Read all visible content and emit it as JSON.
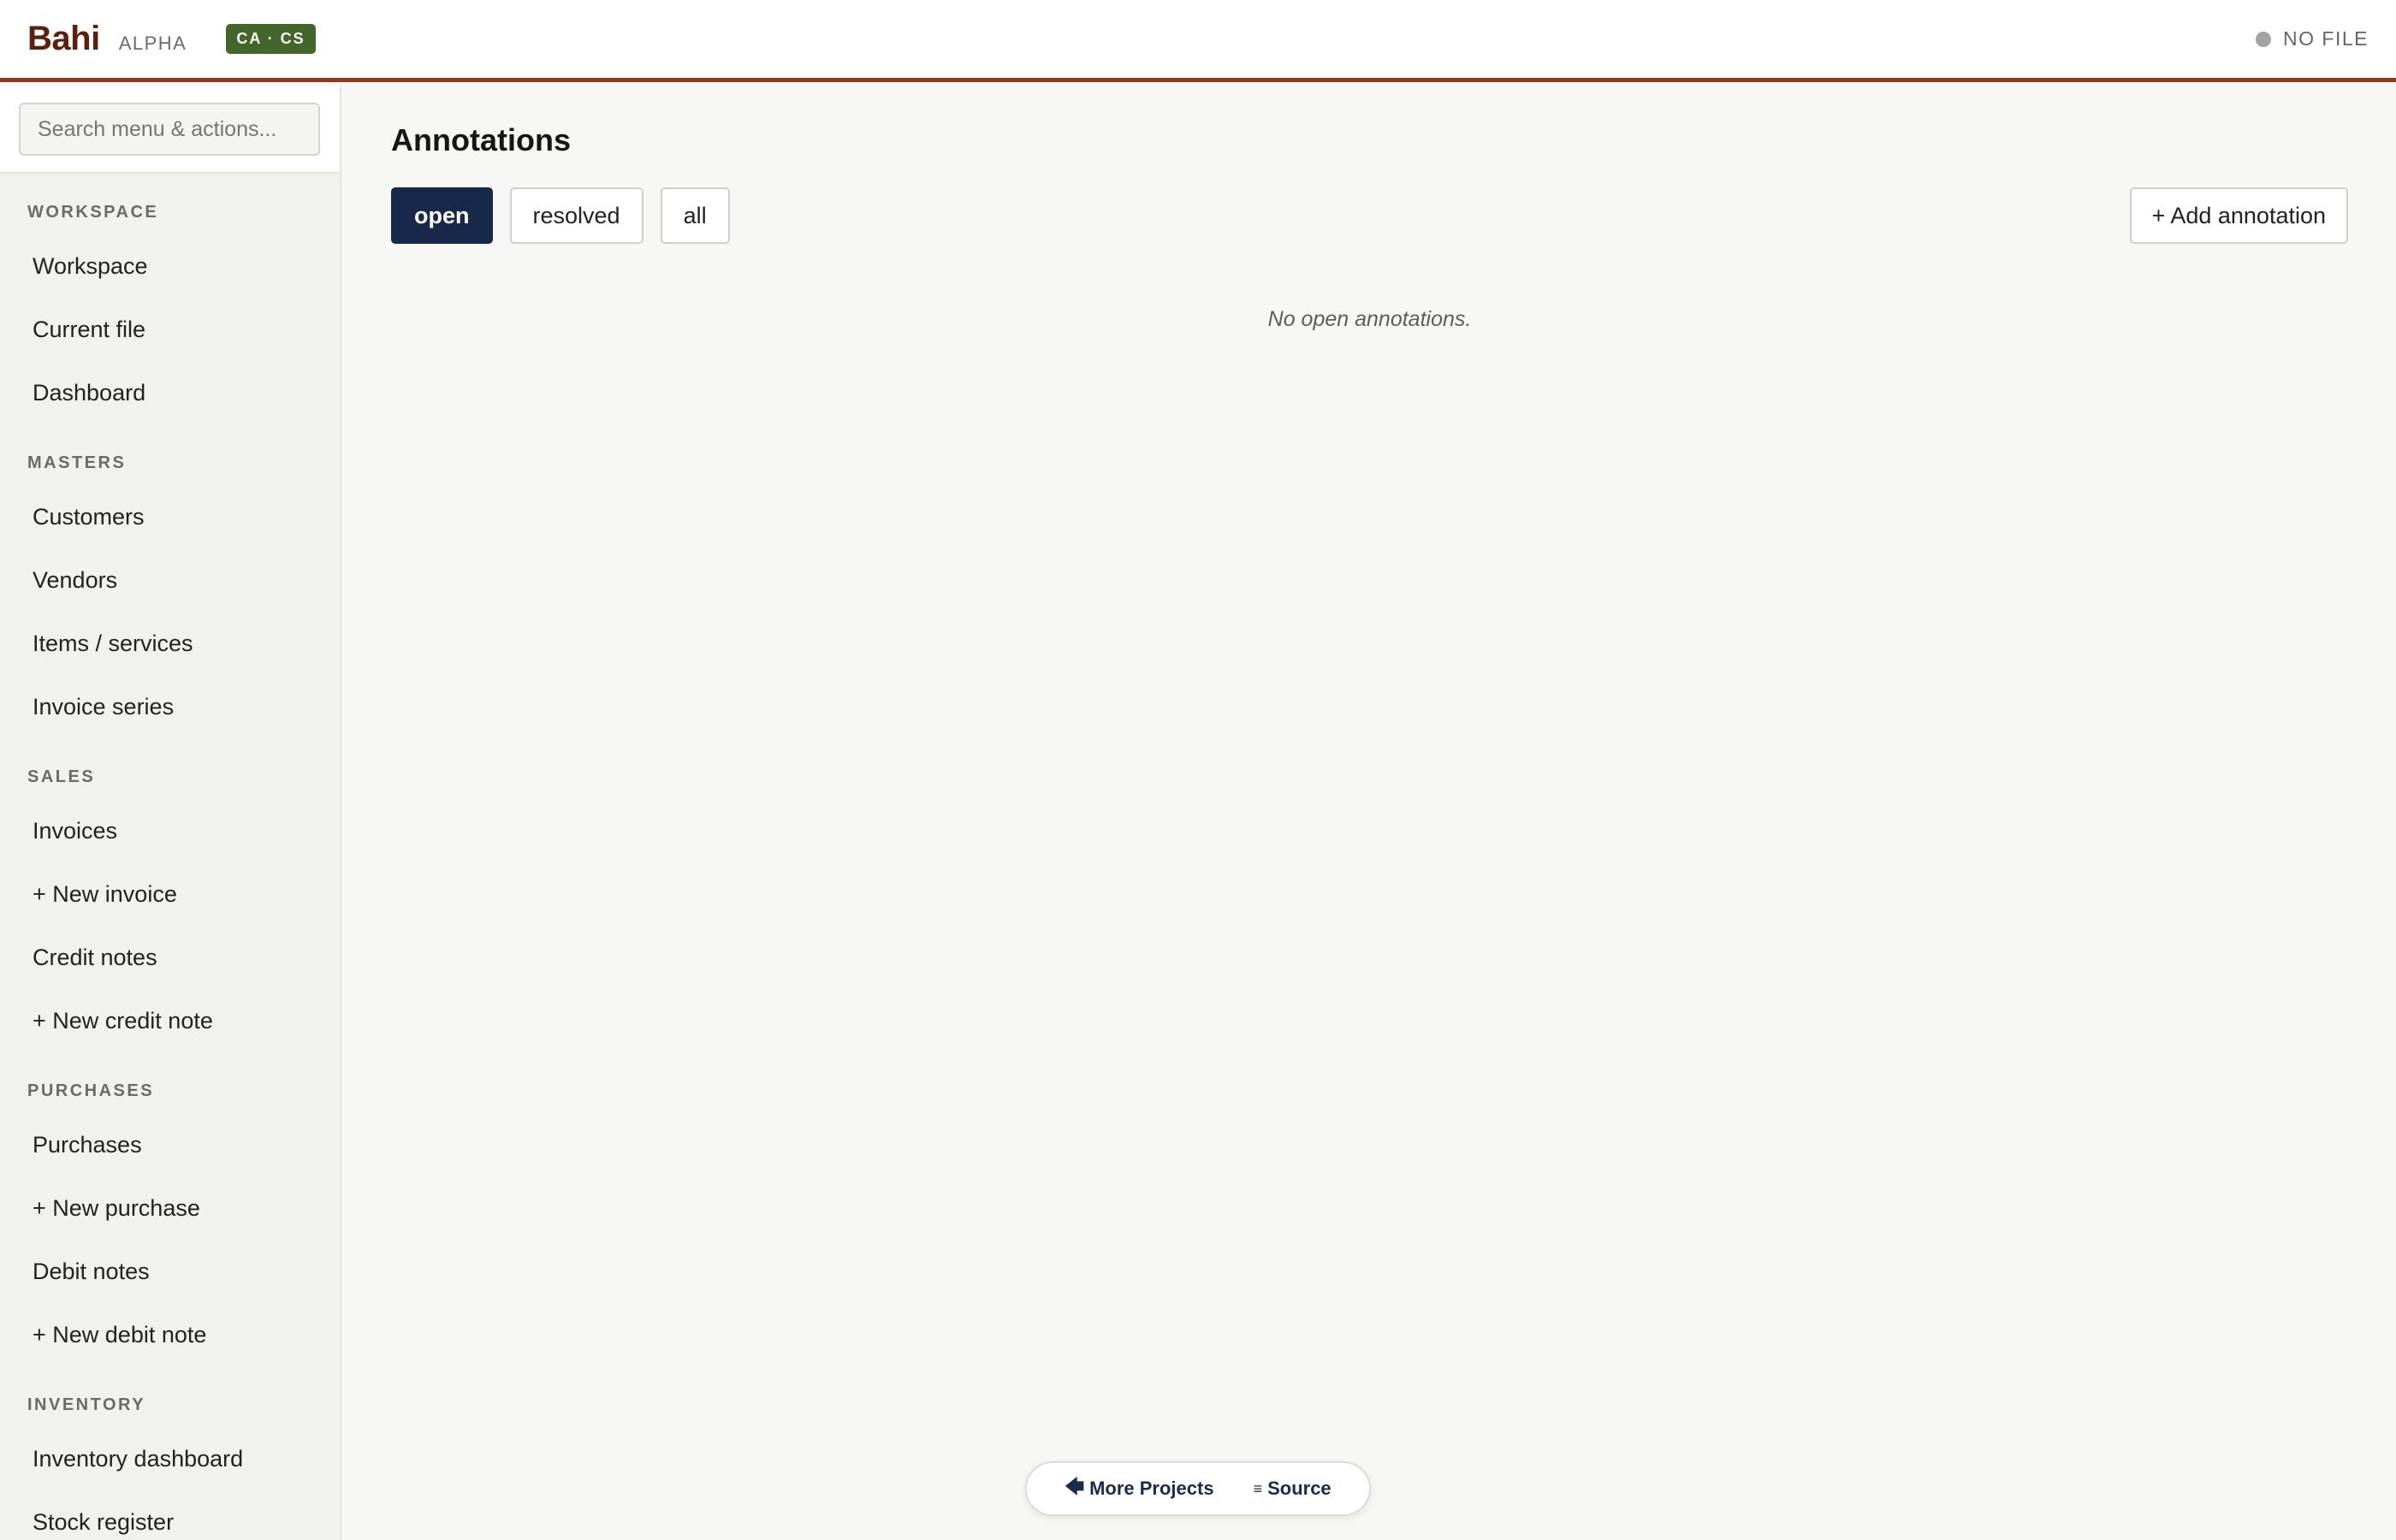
{
  "header": {
    "brand": "Bahi",
    "tag": "ALPHA",
    "mode_badge": "CA · CS",
    "file_status": "NO FILE"
  },
  "sidebar": {
    "search_placeholder": "Search menu & actions...",
    "sections": [
      {
        "heading": "WORKSPACE",
        "items": [
          "Workspace",
          "Current file",
          "Dashboard"
        ]
      },
      {
        "heading": "MASTERS",
        "items": [
          "Customers",
          "Vendors",
          "Items / services",
          "Invoice series"
        ]
      },
      {
        "heading": "SALES",
        "items": [
          "Invoices",
          "+ New invoice",
          "Credit notes",
          "+ New credit note"
        ]
      },
      {
        "heading": "PURCHASES",
        "items": [
          "Purchases",
          "+ New purchase",
          "Debit notes",
          "+ New debit note"
        ]
      },
      {
        "heading": "INVENTORY",
        "items": [
          "Inventory dashboard",
          "Stock register"
        ]
      }
    ]
  },
  "main": {
    "title": "Annotations",
    "filters": [
      "open",
      "resolved",
      "all"
    ],
    "active_filter": "open",
    "add_label": "+ Add annotation",
    "empty_message": "No open annotations."
  },
  "footer": {
    "more_projects": "More Projects",
    "source": "Source"
  },
  "colors": {
    "accent_border": "#8b3a1e",
    "brand": "#5a1f0d",
    "badge": "#45662a",
    "active_filter": "#18284a"
  },
  "icons": {
    "more_projects": "arrow-left-icon",
    "source": "code-icon",
    "status": "status-dot-icon"
  }
}
